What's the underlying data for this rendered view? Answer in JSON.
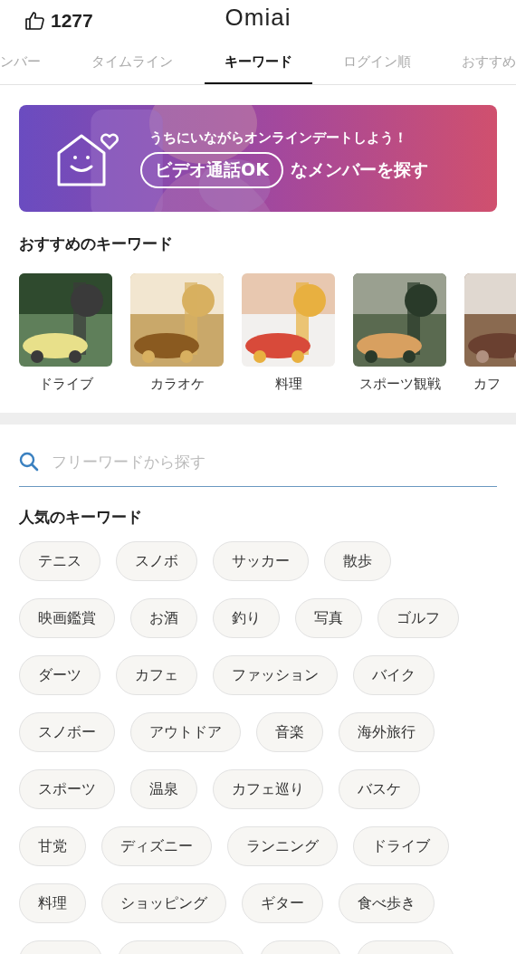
{
  "header": {
    "likes": "1277",
    "logo": "Omiai"
  },
  "tabs": [
    {
      "label": "ンバー",
      "selected": false
    },
    {
      "label": "タイムライン",
      "selected": false
    },
    {
      "label": "キーワード",
      "selected": true
    },
    {
      "label": "ログイン順",
      "selected": false
    },
    {
      "label": "おすすめ",
      "selected": false
    }
  ],
  "banner": {
    "tagline": "うちにいながらオンラインデートしよう！",
    "pill": "ビデオ通話OK",
    "action": "なメンバーを探す"
  },
  "recommended": {
    "title": "おすすめのキーワード",
    "items": [
      {
        "label": "ドライブ"
      },
      {
        "label": "カラオケ"
      },
      {
        "label": "料理"
      },
      {
        "label": "スポーツ観戦"
      },
      {
        "label": "カフ"
      }
    ]
  },
  "search": {
    "placeholder": "フリーワードから探す"
  },
  "popular": {
    "title": "人気のキーワード",
    "rows": [
      [
        "テニス",
        "スノボ",
        "サッカー",
        "散歩"
      ],
      [
        "映画鑑賞",
        "お酒",
        "釣り",
        "写真",
        "ゴルフ"
      ],
      [
        "ダーツ",
        "カフェ",
        "ファッション",
        "バイク"
      ],
      [
        "スノボー",
        "アウトドア",
        "音楽",
        "海外旅行"
      ],
      [
        "スポーツ",
        "温泉",
        "カフェ巡り",
        "バスケ"
      ],
      [
        "甘党",
        "ディズニー",
        "ランニング",
        "ドライブ"
      ],
      [
        "料理",
        "ショッピング",
        "ギター",
        "食べ歩き"
      ]
    ]
  }
}
